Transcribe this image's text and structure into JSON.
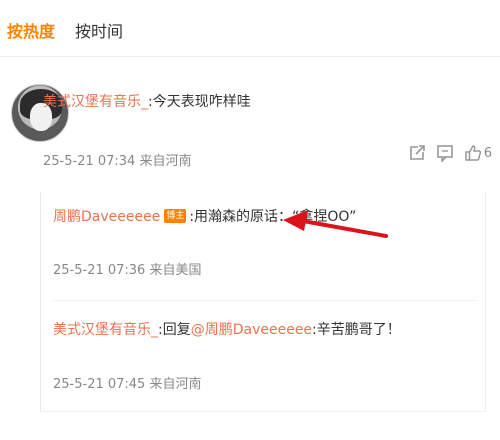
{
  "tabs": {
    "hot": "按热度",
    "time": "按时间"
  },
  "main_comment": {
    "user": "美式汉堡有音乐_",
    "text": ":今天表现咋样哇",
    "timestamp": "25-5-21 07:34 来自河南",
    "like_count": "6"
  },
  "replies": [
    {
      "user": "周鹏Daveeeeee",
      "badge": "博主",
      "text": ":用瀚森的原话：“拿捏OO”",
      "timestamp": "25-5-21 07:36 来自美国"
    },
    {
      "user": "美式汉堡有音乐_",
      "text_prefix": ":回复",
      "mention": "@周鹏Daveeeeee",
      "text_suffix": ":辛苦鹏哥了！",
      "timestamp": "25-5-21 07:45 来自河南"
    }
  ],
  "icons": {
    "share": "share-icon",
    "comment": "comment-icon",
    "like": "thumbs-up-icon",
    "arrow": "red-arrow-annotation"
  },
  "colors": {
    "accent": "#ff8200",
    "username": "#eb7350",
    "meta": "#888888",
    "arrow": "#d9141a"
  }
}
